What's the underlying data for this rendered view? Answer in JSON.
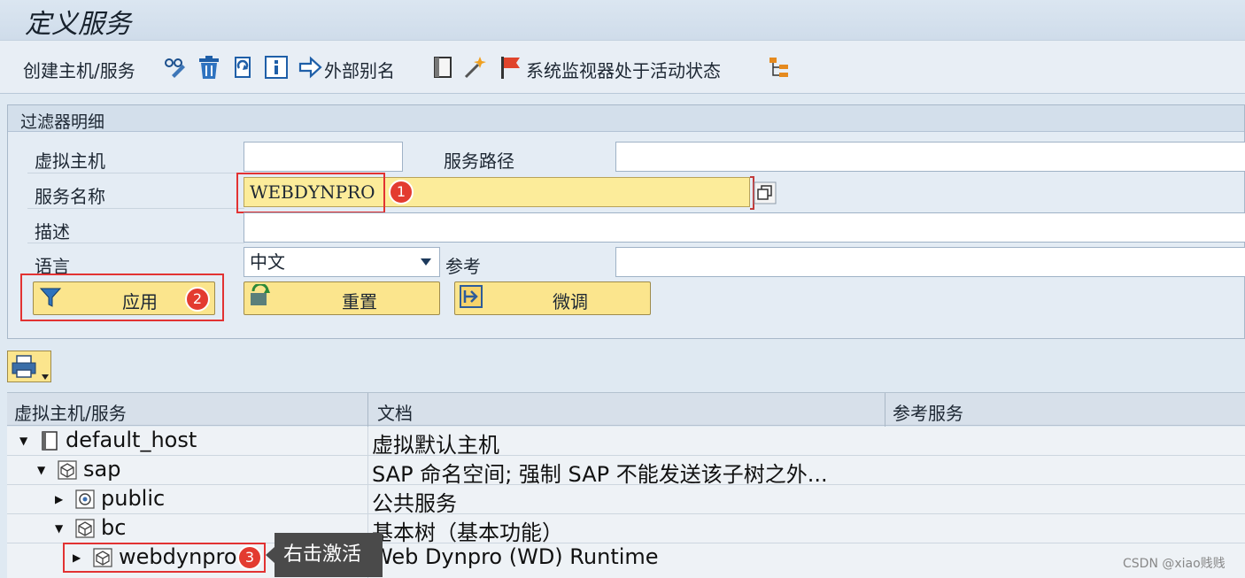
{
  "title": "定义服务",
  "toolbar": {
    "create_label": "创建主机/服务",
    "alias_label": "外部别名",
    "monitor_label": "系统监视器处于活动状态"
  },
  "filter": {
    "section_title": "过滤器明细",
    "virtual_host_label": "虚拟主机",
    "virtual_host_value": "",
    "service_path_label": "服务路径",
    "service_path_value": "",
    "service_name_label": "服务名称",
    "service_name_value": "WEBDYNPRO",
    "description_label": "描述",
    "description_value": "",
    "language_label": "语言",
    "language_value": "中文",
    "reference_label": "参考",
    "reference_value": "",
    "apply_button": "应用",
    "reset_button": "重置",
    "finetune_button": "微调"
  },
  "annotations": {
    "badge1": "1",
    "badge2": "2",
    "badge3": "3",
    "tooltip": "右击激活"
  },
  "table": {
    "columns": [
      "虚拟主机/服务",
      "文档",
      "参考服务"
    ],
    "rows": [
      {
        "name": "default_host",
        "doc": "虚拟默认主机",
        "ref": ""
      },
      {
        "name": "sap",
        "doc": "SAP 命名空间; 强制 SAP 不能发送该子树之外...",
        "ref": ""
      },
      {
        "name": "public",
        "doc": "公共服务",
        "ref": ""
      },
      {
        "name": "bc",
        "doc": "基本树（基本功能）",
        "ref": ""
      },
      {
        "name": "webdynpro",
        "doc": "Web Dynpro (WD) Runtime",
        "ref": ""
      }
    ]
  },
  "watermark": "CSDN @xiao贱贱",
  "colors": {
    "button_yellow": "#fbe58d",
    "annotation_red": "#e33b30",
    "highlight_field": "#fcec9a"
  }
}
